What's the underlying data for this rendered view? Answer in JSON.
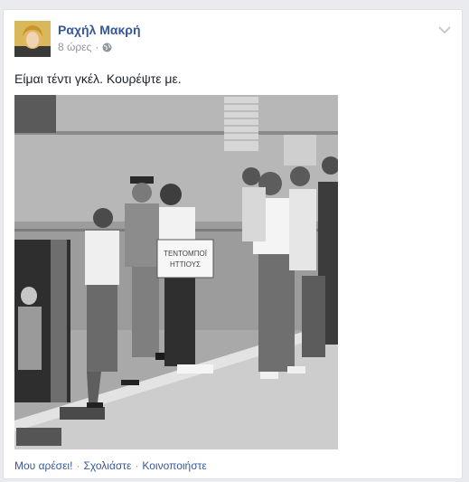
{
  "post": {
    "author": "Ραχήλ Μακρή",
    "time": "8 ώρες",
    "separator": "·",
    "text": "Είμαι τέντι γκέλ. Κουρέψτε με."
  },
  "photo": {
    "sign_line1": "ΤΕΝΤΟΜΠΟΪ",
    "sign_line2": "ΗΤΤΙΟΥΣ"
  },
  "actions": {
    "like": "Μου αρέσει!",
    "comment": "Σχολιάστε",
    "share": "Κοινοποιήστε",
    "dot": "·"
  },
  "icons": {
    "privacy": "globe-icon",
    "menu": "chevron-down-icon"
  },
  "colors": {
    "link": "#365899",
    "meta": "#90949c",
    "background": "#e9ebee"
  }
}
